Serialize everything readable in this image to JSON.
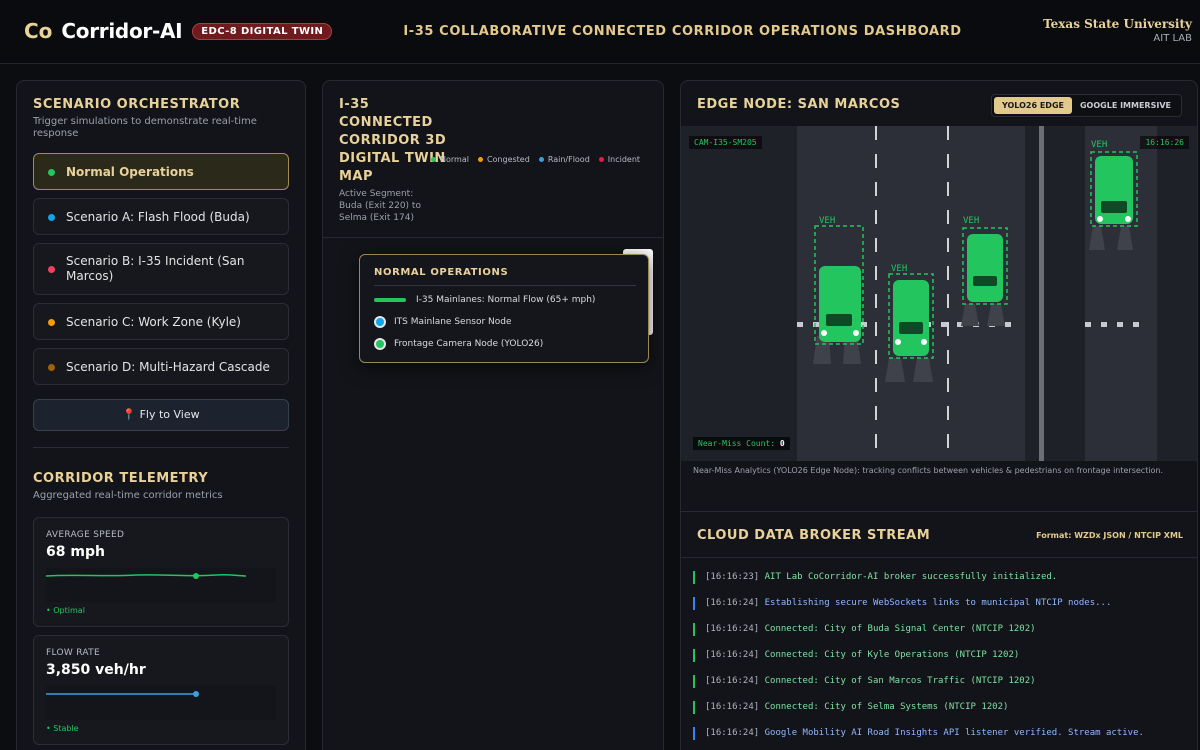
{
  "header": {
    "logo": "Co",
    "app_name": "Corridor-AI",
    "badge": "EDC-8 DIGITAL TWIN",
    "title": "I-35 COLLABORATIVE CONNECTED CORRIDOR OPERATIONS DASHBOARD",
    "university": "Texas State University",
    "lab": "AIT LAB"
  },
  "orchestrator": {
    "title": "SCENARIO ORCHESTRATOR",
    "subtitle": "Trigger simulations to demonstrate real-time response",
    "scenarios": [
      {
        "label": "Normal Operations",
        "color": "#22c55e",
        "active": true
      },
      {
        "label": "Scenario A: Flash Flood (Buda)",
        "color": "#0ea5e9",
        "active": false
      },
      {
        "label": "Scenario B: I-35 Incident (San Marcos)",
        "color": "#f43f5e",
        "active": false
      },
      {
        "label": "Scenario C: Work Zone (Kyle)",
        "color": "#f59e0b",
        "active": false
      },
      {
        "label": "Scenario D: Multi-Hazard Cascade",
        "color": "#a16207",
        "active": false
      }
    ],
    "fly_button": "📍 Fly to View"
  },
  "telemetry": {
    "title": "CORRIDOR TELEMETRY",
    "subtitle": "Aggregated real-time corridor metrics",
    "cards": [
      {
        "label": "AVERAGE SPEED",
        "value": "68 mph",
        "status": "• Optimal",
        "color": "#22c55e"
      },
      {
        "label": "FLOW RATE",
        "value": "3,850 veh/hr",
        "status": "• Stable",
        "color": "#3b9fe0"
      }
    ]
  },
  "map": {
    "title": "I-35 CONNECTED CORRIDOR 3D DIGITAL TWIN MAP",
    "active_segment": "Active Segment: Buda (Exit 220) to Selma (Exit 174)",
    "legend": [
      {
        "label": "Normal",
        "color": "#22c55e"
      },
      {
        "label": "Congested",
        "color": "#f59e0b"
      },
      {
        "label": "Rain/Flood",
        "color": "#3b9fe0"
      },
      {
        "label": "Incident",
        "color": "#e11d48"
      }
    ],
    "popup": {
      "title": "NORMAL OPERATIONS",
      "flow": "I-35 Mainlanes: Normal Flow (65+ mph)",
      "sensor": "ITS Mainlane Sensor Node",
      "camera": "Frontage Camera Node (YOLO26)"
    }
  },
  "edge": {
    "title": "EDGE NODE: SAN MARCOS",
    "toggle": [
      "YOLO26 EDGE",
      "GOOGLE IMMERSIVE"
    ],
    "camera_id": "CAM-I35-SM205",
    "time": "16:16:26",
    "vehicle_label": "VEH",
    "near_miss_label": "Near-Miss Count:",
    "near_miss_value": "0",
    "caption": "Near-Miss Analytics (YOLO26 Edge Node): tracking conflicts between vehicles & pedestrians on frontage intersection."
  },
  "stream": {
    "title": "CLOUD DATA BROKER STREAM",
    "format": "Format: WZDx JSON / NTCIP XML",
    "logs": [
      {
        "ts": "[16:16:23]",
        "msg": "AIT Lab CoCorridor-AI broker successfully initialized.",
        "kind": "g"
      },
      {
        "ts": "[16:16:24]",
        "msg": "Establishing secure WebSockets links to municipal NTCIP nodes...",
        "kind": "b"
      },
      {
        "ts": "[16:16:24]",
        "msg": "Connected: City of Buda Signal Center (NTCIP 1202)",
        "kind": "g"
      },
      {
        "ts": "[16:16:24]",
        "msg": "Connected: City of Kyle Operations (NTCIP 1202)",
        "kind": "g"
      },
      {
        "ts": "[16:16:24]",
        "msg": "Connected: City of San Marcos Traffic (NTCIP 1202)",
        "kind": "g"
      },
      {
        "ts": "[16:16:24]",
        "msg": "Connected: City of Selma Systems (NTCIP 1202)",
        "kind": "g"
      },
      {
        "ts": "[16:16:24]",
        "msg": "Google Mobility AI Road Insights API listener verified. Stream active.",
        "kind": "b"
      }
    ]
  }
}
